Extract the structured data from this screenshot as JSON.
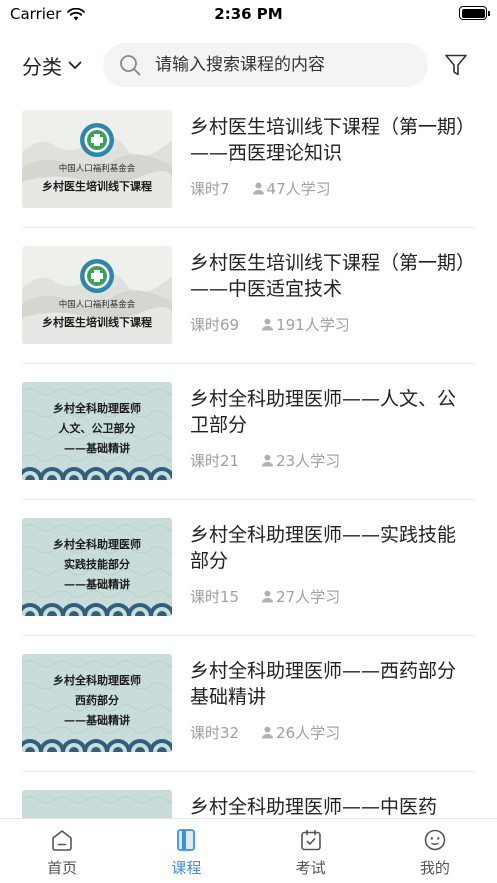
{
  "status_bar": {
    "carrier": "Carrier",
    "time": "2:36 PM"
  },
  "header": {
    "category_label": "分类",
    "search_placeholder": "请输入搜索课程的内容"
  },
  "colors": {
    "accent": "#3d8fe0",
    "meta_text": "#a0a0a0",
    "thumb_teal": "#c8dcd9",
    "thumb_ink": "#eef0ec"
  },
  "courses": [
    {
      "title": "乡村医生培训线下课程（第一期）——西医理论知识",
      "lessons": "课时7",
      "learners": "47人学习",
      "thumb": {
        "type": "ink",
        "line1": "中国人口福利基金会",
        "line2": "乡村医生培训线下课程"
      }
    },
    {
      "title": "乡村医生培训线下课程（第一期）——中医适宜技术",
      "lessons": "课时69",
      "learners": "191人学习",
      "thumb": {
        "type": "ink",
        "line1": "中国人口福利基金会",
        "line2": "乡村医生培训线下课程"
      }
    },
    {
      "title": "乡村全科助理医师——人文、公卫部分",
      "lessons": "课时21",
      "learners": "23人学习",
      "thumb": {
        "type": "wave",
        "line1": "乡村全科助理医师",
        "line2": "人文、公卫部分",
        "line3": "——基础精讲"
      }
    },
    {
      "title": "乡村全科助理医师——实践技能部分",
      "lessons": "课时15",
      "learners": "27人学习",
      "thumb": {
        "type": "wave",
        "line1": "乡村全科助理医师",
        "line2": "实践技能部分",
        "line3": "——基础精讲"
      }
    },
    {
      "title": "乡村全科助理医师——西药部分基础精讲",
      "lessons": "课时32",
      "learners": "26人学习",
      "thumb": {
        "type": "wave",
        "line1": "乡村全科助理医师",
        "line2": "西药部分",
        "line3": "——基础精讲"
      }
    },
    {
      "title": "乡村全科助理医师——中医药",
      "lessons": "",
      "learners": "",
      "thumb": {
        "type": "wave",
        "line1": "",
        "line2": "",
        "line3": ""
      }
    }
  ],
  "tabs": [
    {
      "label": "首页",
      "icon": "home-icon",
      "active": false
    },
    {
      "label": "课程",
      "icon": "course-book-icon",
      "active": true
    },
    {
      "label": "考试",
      "icon": "exam-calendar-icon",
      "active": false
    },
    {
      "label": "我的",
      "icon": "profile-face-icon",
      "active": false
    }
  ]
}
